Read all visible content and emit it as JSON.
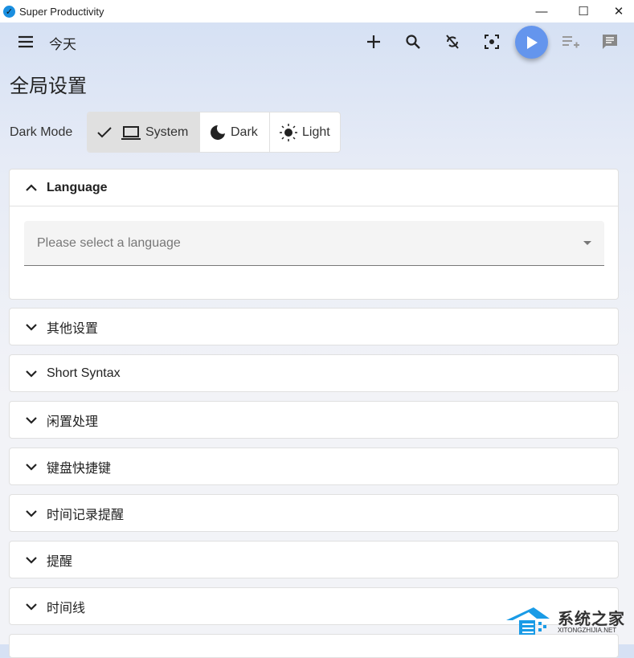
{
  "window": {
    "title": "Super Productivity",
    "minimize": "—",
    "maximize": "☐",
    "close": "✕"
  },
  "appbar": {
    "page": "今天"
  },
  "page_title": "全局设置",
  "dark_mode": {
    "label": "Dark Mode",
    "options": [
      {
        "label": "System",
        "selected": true
      },
      {
        "label": "Dark",
        "selected": false
      },
      {
        "label": "Light",
        "selected": false
      }
    ]
  },
  "language": {
    "title": "Language",
    "placeholder": "Please select a language"
  },
  "sections": [
    "其他设置",
    "Short Syntax",
    "闲置处理",
    "键盘快捷键",
    "时间记录提醒",
    "提醒",
    "时间线"
  ],
  "watermark": {
    "title": "系统之家",
    "subtitle": "XITONGZHIJIA.NET"
  }
}
